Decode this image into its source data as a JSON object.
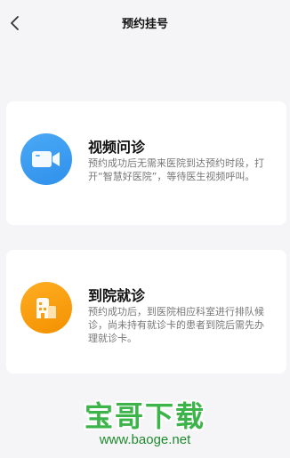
{
  "header": {
    "title": "预约挂号",
    "back_icon": "chevron-left-icon"
  },
  "options": [
    {
      "title": "视频问诊",
      "description": "预约成功后无需来医院到达预约时段，打开“智慧好医院”，等待医生视频呼叫。",
      "icon": "video-camera-icon",
      "color": "#3a9cf0"
    },
    {
      "title": "到院就诊",
      "description": "预约成功后，到医院相应科室进行排队候诊，尚未持有就诊卡的患者到院后需先办理就诊卡。",
      "icon": "hospital-building-icon",
      "color": "#f7a11a"
    }
  ],
  "watermark": {
    "brand": "宝哥下载",
    "url": "www.baoge.net",
    "color": "#3db44a"
  }
}
